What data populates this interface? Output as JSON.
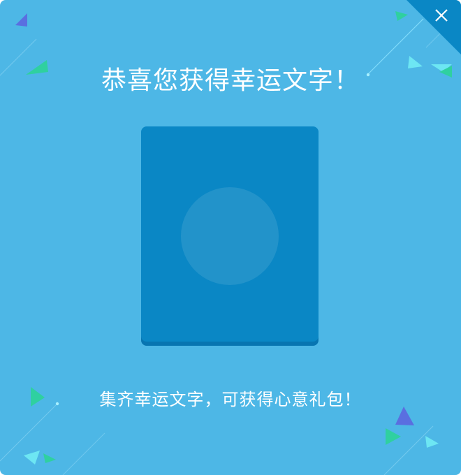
{
  "dialog": {
    "title": "恭喜您获得幸运文字！",
    "subtitle": "集齐幸运文字，可获得心意礼包！",
    "close_icon": "close-icon"
  },
  "colors": {
    "background": "#4db7e6",
    "card": "#0a87c5",
    "corner": "#0a87c5",
    "text": "#ffffff"
  }
}
